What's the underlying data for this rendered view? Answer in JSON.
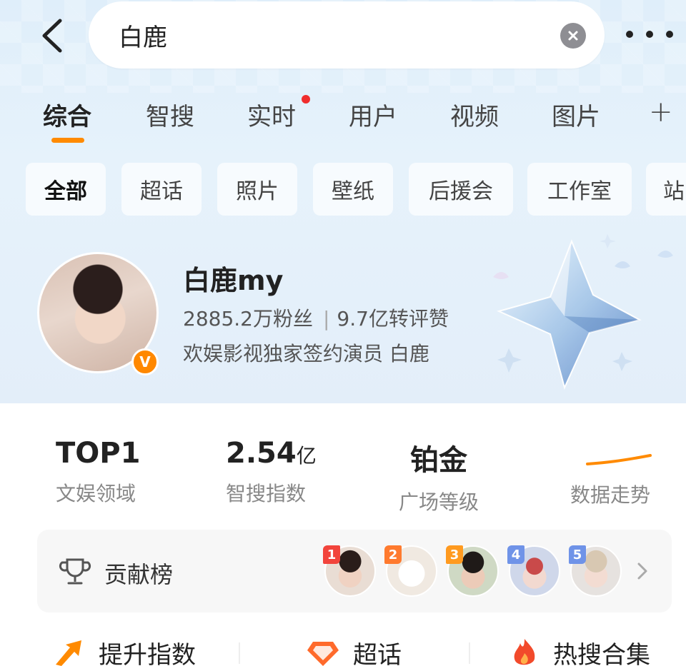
{
  "header": {
    "search_query": "白鹿",
    "back_icon": "chevron-left-icon",
    "clear_icon": "clear-circle-icon",
    "more_icon": "more-dots-icon"
  },
  "tabs": [
    {
      "label": "综合",
      "active": true
    },
    {
      "label": "智搜"
    },
    {
      "label": "实时",
      "badge": "red-dot"
    },
    {
      "label": "用户"
    },
    {
      "label": "视频"
    },
    {
      "label": "图片"
    }
  ],
  "tabs_add_label": "+",
  "filters": [
    {
      "label": "全部",
      "active": true
    },
    {
      "label": "超话"
    },
    {
      "label": "照片"
    },
    {
      "label": "壁纸"
    },
    {
      "label": "后援会"
    },
    {
      "label": "工作室"
    },
    {
      "label": "站"
    }
  ],
  "profile": {
    "name": "白鹿my",
    "fans": "2885.2万粉丝",
    "separator": "|",
    "engagement": "9.7亿转评赞",
    "bio": "欢娱影视独家签约演员 白鹿",
    "verified_badge": "V"
  },
  "metrics": [
    {
      "value": "TOP1",
      "unit": "",
      "label": "文娱领域"
    },
    {
      "value": "2.54",
      "unit": "亿",
      "label": "智搜指数"
    },
    {
      "value": "铂金",
      "unit": "",
      "label": "广场等级"
    },
    {
      "value": "",
      "unit": "",
      "label": "数据走势"
    }
  ],
  "ranking": {
    "title": "贡献榜",
    "icon": "trophy-icon",
    "ranks": [
      "1",
      "2",
      "3",
      "4",
      "5"
    ]
  },
  "actions": [
    {
      "label": "提升指数",
      "icon": "arrow-up-icon"
    },
    {
      "label": "超话",
      "icon": "diamond-icon"
    },
    {
      "label": "热搜合集",
      "icon": "fire-icon"
    }
  ],
  "colors": {
    "accent": "#ff8a00",
    "red_dot": "#f02d2d",
    "rank_colors": [
      "#f2443c",
      "#ff7a2e",
      "#ff9a1f",
      "#6f93e8",
      "#6f93e8"
    ]
  }
}
